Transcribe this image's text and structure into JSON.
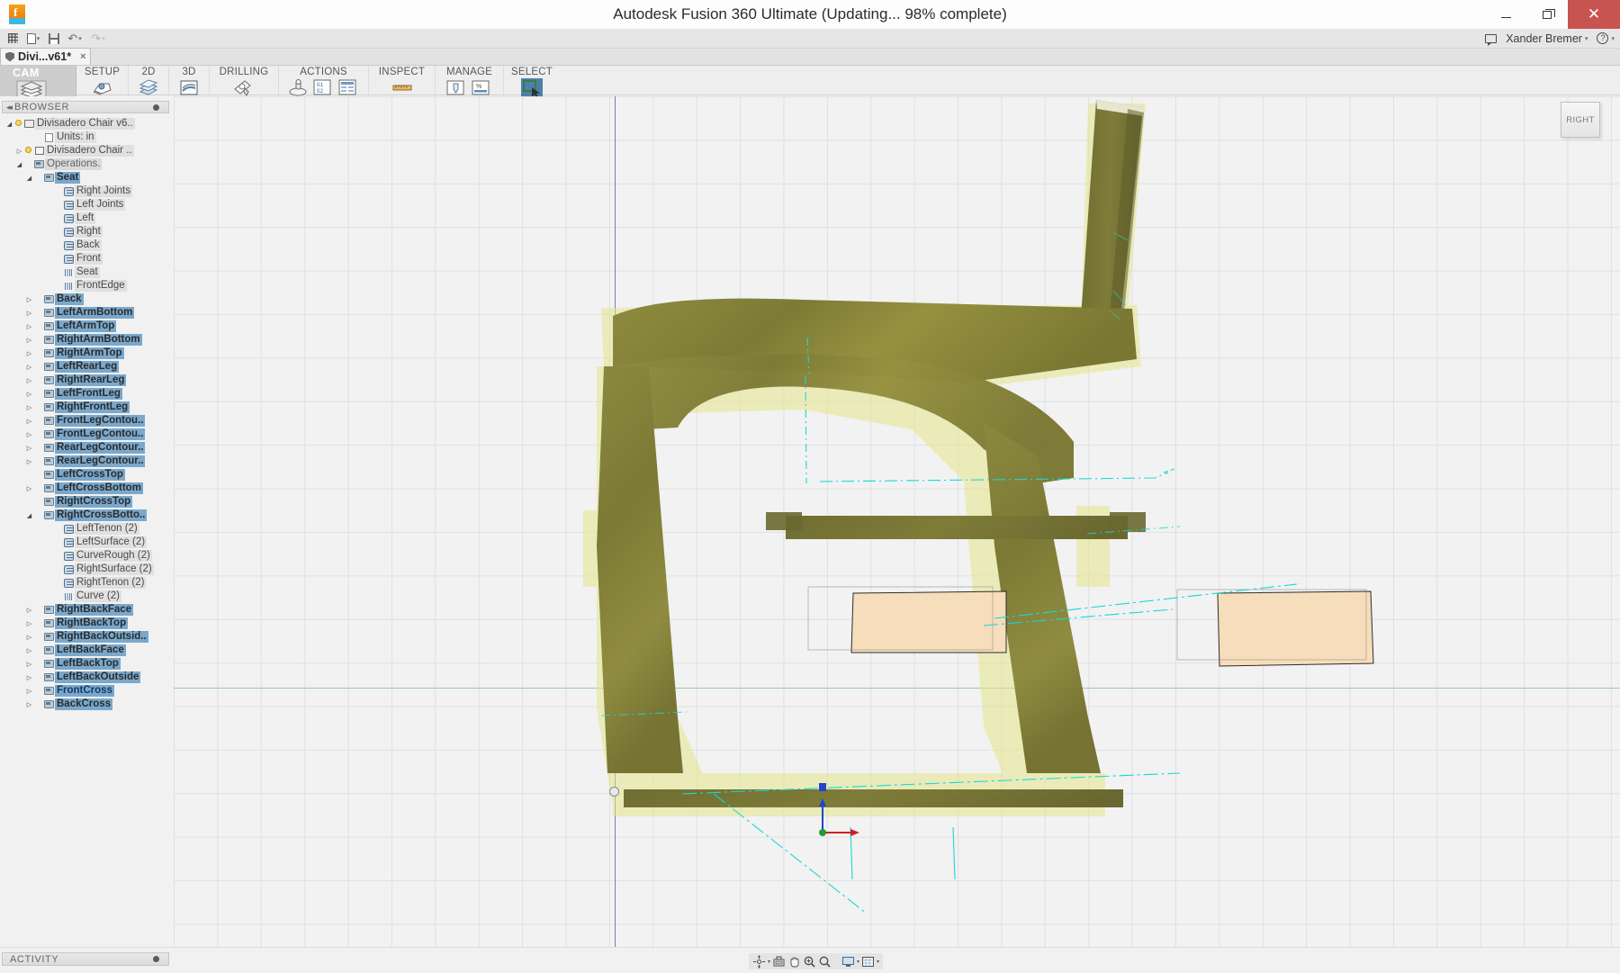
{
  "window": {
    "title": "Autodesk Fusion 360 Ultimate  (Updating... 98% complete)",
    "app_icon": "fusion-logo-icon",
    "minimize_label": "",
    "maximize_label": "",
    "close_label": "✕"
  },
  "quick_access": {
    "icons": [
      "grid-icon",
      "new-document-icon",
      "save-icon",
      "undo-icon",
      "redo-icon"
    ],
    "user_name": "Xander Bremer",
    "user_caret": "▾",
    "chat_icon": "chat-icon",
    "help_icon": "help-icon",
    "help_glyph": "?",
    "collapse_glyph": "⌃"
  },
  "tabs": [
    {
      "label": "Divi...v61*",
      "close": "×",
      "icon": "shield-icon",
      "active": true
    }
  ],
  "ribbon": {
    "tab_name": "",
    "cam_label": "CAM",
    "cam_icon": "cam-stack-icon",
    "groups": [
      {
        "label": "SETUP",
        "icons": [
          "setup-icon"
        ],
        "caret": "▾",
        "has_caret": true
      },
      {
        "label": "2D",
        "icons": [
          "2d-toolpath-icon"
        ],
        "caret": "▾",
        "has_caret": true
      },
      {
        "label": "3D",
        "icons": [
          "3d-toolpath-icon"
        ],
        "caret": "▾",
        "has_caret": true
      },
      {
        "label": "DRILLING",
        "icons": [
          "drilling-icon"
        ],
        "caret": "",
        "has_caret": false
      },
      {
        "label": "ACTIONS",
        "icons": [
          "simulate-icon",
          "g-code-icon",
          "setup-sheet-icon"
        ],
        "caret": "▾",
        "has_caret": true
      },
      {
        "label": "INSPECT",
        "icons": [
          "measure-icon"
        ],
        "caret": "",
        "has_caret": false
      },
      {
        "label": "MANAGE",
        "icons": [
          "tool-library-icon",
          "machining-time-icon"
        ],
        "caret": "▾",
        "has_caret": true
      },
      {
        "label": "SELECT",
        "icons": [
          "select-cursor-icon"
        ],
        "caret": "",
        "has_caret": false
      }
    ]
  },
  "browser": {
    "header": "BROWSER",
    "collapse_glyph": "◂◂",
    "tree": [
      {
        "label": "Divisadero Chair v6..",
        "indent": 0,
        "twist": "◢",
        "bulb": true,
        "icon": "component-icon",
        "style": "lite"
      },
      {
        "label": "Units: in",
        "indent": 2,
        "twist": "",
        "bulb": false,
        "icon": "document-icon",
        "style": "lite"
      },
      {
        "label": "Divisadero Chair ..",
        "indent": 1,
        "twist": "▷",
        "bulb": true,
        "icon": "body-icon",
        "style": "lite"
      },
      {
        "label": "Operations.",
        "indent": 1,
        "twist": "◢",
        "bulb": false,
        "icon": "setup-icon",
        "style": "faint"
      },
      {
        "label": "Seat",
        "indent": 2,
        "twist": "◢",
        "bulb": false,
        "icon": "setup-icon",
        "style": "sel"
      },
      {
        "label": "Right Joints",
        "indent": 4,
        "twist": "",
        "bulb": false,
        "icon": "operation-icon",
        "style": "lite"
      },
      {
        "label": "Left Joints",
        "indent": 4,
        "twist": "",
        "bulb": false,
        "icon": "operation-icon",
        "style": "lite"
      },
      {
        "label": "Left",
        "indent": 4,
        "twist": "",
        "bulb": false,
        "icon": "operation-icon",
        "style": "lite"
      },
      {
        "label": "Right",
        "indent": 4,
        "twist": "",
        "bulb": false,
        "icon": "operation-icon",
        "style": "lite"
      },
      {
        "label": "Back",
        "indent": 4,
        "twist": "",
        "bulb": false,
        "icon": "operation-icon",
        "style": "lite"
      },
      {
        "label": "Front",
        "indent": 4,
        "twist": "",
        "bulb": false,
        "icon": "operation-icon",
        "style": "lite"
      },
      {
        "label": "Seat",
        "indent": 4,
        "twist": "",
        "bulb": false,
        "icon": "curve-icon",
        "style": "lite"
      },
      {
        "label": "FrontEdge",
        "indent": 4,
        "twist": "",
        "bulb": false,
        "icon": "curve-icon",
        "style": "lite"
      },
      {
        "label": "Back",
        "indent": 2,
        "twist": "▷",
        "bulb": false,
        "icon": "setup-icon",
        "style": "sel"
      },
      {
        "label": "LeftArmBottom",
        "indent": 2,
        "twist": "▷",
        "bulb": false,
        "icon": "setup-icon",
        "style": "sel"
      },
      {
        "label": "LeftArmTop",
        "indent": 2,
        "twist": "▷",
        "bulb": false,
        "icon": "setup-icon",
        "style": "sel"
      },
      {
        "label": "RightArmBottom",
        "indent": 2,
        "twist": "▷",
        "bulb": false,
        "icon": "setup-icon",
        "style": "sel"
      },
      {
        "label": "RightArmTop",
        "indent": 2,
        "twist": "▷",
        "bulb": false,
        "icon": "setup-icon",
        "style": "sel"
      },
      {
        "label": "LeftRearLeg",
        "indent": 2,
        "twist": "▷",
        "bulb": false,
        "icon": "setup-icon",
        "style": "sel"
      },
      {
        "label": "RightRearLeg",
        "indent": 2,
        "twist": "▷",
        "bulb": false,
        "icon": "setup-icon",
        "style": "sel"
      },
      {
        "label": "LeftFrontLeg",
        "indent": 2,
        "twist": "▷",
        "bulb": false,
        "icon": "setup-icon",
        "style": "sel"
      },
      {
        "label": "RightFrontLeg",
        "indent": 2,
        "twist": "▷",
        "bulb": false,
        "icon": "setup-icon",
        "style": "sel"
      },
      {
        "label": "FrontLegContou..",
        "indent": 2,
        "twist": "▷",
        "bulb": false,
        "icon": "setup-icon",
        "style": "sel"
      },
      {
        "label": "FrontLegContou..",
        "indent": 2,
        "twist": "▷",
        "bulb": false,
        "icon": "setup-icon",
        "style": "sel"
      },
      {
        "label": "RearLegContour..",
        "indent": 2,
        "twist": "▷",
        "bulb": false,
        "icon": "setup-icon",
        "style": "sel"
      },
      {
        "label": "RearLegContour..",
        "indent": 2,
        "twist": "▷",
        "bulb": false,
        "icon": "setup-icon",
        "style": "sel"
      },
      {
        "label": "LeftCrossTop",
        "indent": 2,
        "twist": "",
        "bulb": false,
        "icon": "setup-icon",
        "style": "sel"
      },
      {
        "label": "LeftCrossBottom",
        "indent": 2,
        "twist": "▷",
        "bulb": false,
        "icon": "setup-icon",
        "style": "sel"
      },
      {
        "label": "RightCrossTop",
        "indent": 2,
        "twist": "",
        "bulb": false,
        "icon": "setup-icon",
        "style": "sel"
      },
      {
        "label": "RightCrossBotto..",
        "indent": 2,
        "twist": "◢",
        "bulb": false,
        "icon": "setup-icon",
        "style": "sel"
      },
      {
        "label": "LeftTenon (2)",
        "indent": 4,
        "twist": "",
        "bulb": false,
        "icon": "operation-icon",
        "style": "lite"
      },
      {
        "label": "LeftSurface (2)",
        "indent": 4,
        "twist": "",
        "bulb": false,
        "icon": "operation-icon",
        "style": "lite"
      },
      {
        "label": "CurveRough (2)",
        "indent": 4,
        "twist": "",
        "bulb": false,
        "icon": "operation-icon",
        "style": "lite"
      },
      {
        "label": "RightSurface (2)",
        "indent": 4,
        "twist": "",
        "bulb": false,
        "icon": "operation-icon",
        "style": "lite"
      },
      {
        "label": "RightTenon (2)",
        "indent": 4,
        "twist": "",
        "bulb": false,
        "icon": "operation-icon",
        "style": "lite"
      },
      {
        "label": "Curve (2)",
        "indent": 4,
        "twist": "",
        "bulb": false,
        "icon": "curve-icon",
        "style": "lite"
      },
      {
        "label": "RightBackFace",
        "indent": 2,
        "twist": "▷",
        "bulb": false,
        "icon": "setup-icon",
        "style": "sel"
      },
      {
        "label": "RightBackTop",
        "indent": 2,
        "twist": "▷",
        "bulb": false,
        "icon": "setup-icon",
        "style": "sel"
      },
      {
        "label": "RightBackOutsid..",
        "indent": 2,
        "twist": "▷",
        "bulb": false,
        "icon": "setup-icon",
        "style": "sel"
      },
      {
        "label": "LeftBackFace",
        "indent": 2,
        "twist": "▷",
        "bulb": false,
        "icon": "setup-icon",
        "style": "sel"
      },
      {
        "label": "LeftBackTop",
        "indent": 2,
        "twist": "▷",
        "bulb": false,
        "icon": "setup-icon",
        "style": "sel"
      },
      {
        "label": "LeftBackOutside",
        "indent": 2,
        "twist": "▷",
        "bulb": false,
        "icon": "setup-icon",
        "style": "sel"
      },
      {
        "label": "FrontCross",
        "indent": 2,
        "twist": "▷",
        "bulb": false,
        "icon": "setup-icon",
        "style": "sel frontcross"
      },
      {
        "label": "BackCross",
        "indent": 2,
        "twist": "▷",
        "bulb": false,
        "icon": "setup-icon",
        "style": "sel"
      }
    ]
  },
  "viewport": {
    "view_cube_label": "RIGHT",
    "model_name": "divisadero-chair-model",
    "colors": {
      "stock_translucent": "#e3e58f",
      "wood_body": "#8d8a3e",
      "wood_dark": "#6e6c30",
      "tenon_tan": "#f6ddbb",
      "toolpath_cyan": "#1fe0e0",
      "axis_x": "#cc2222",
      "axis_y": "#22aa33",
      "axis_z": "#2244cc",
      "grid": "#e0e0e0",
      "background": "#f2f2f2"
    }
  },
  "statusbar": {
    "activity_label": "ACTIVITY",
    "nav_icons": [
      "orbit-icon",
      "look-at-icon",
      "pan-icon",
      "zoom-in-icon",
      "fit-icon",
      "display-settings-icon",
      "grid-snaps-icon"
    ],
    "nav_carets": "▾"
  }
}
